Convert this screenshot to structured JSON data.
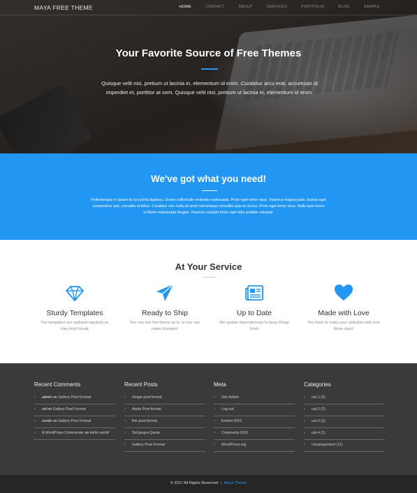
{
  "brand": "MAYA FREE THEME",
  "nav": [
    "HOME",
    "CONTACT",
    "ABOUT",
    "SERVICES",
    "PORTFOLIO",
    "BLOG",
    "SAMPLE"
  ],
  "nav_active": "HOME",
  "hero": {
    "title": "Your Favorite Source of Free Themes",
    "text": "Quisque velit nisi, pretium ut lacinia in, elementum id enim. Curabitur arcu erat, accumsan id imperdiet et, porttitor at sem. Quisque velit nisi, pretium ut lacinia in, elementum id enim."
  },
  "band": {
    "title": "We've got what you need!",
    "text": "Pellentesque in ipsum id orci porta dapibus. Donec sollicitudin molestie malesuada. Proin eget tortor risus. Vivamus magna justo, lacinia eget consectetur sed, convallis at tellus. Curabitur non nulla sit amet nisl tempus convallis quis ac lectus. Proin eget tortor risus. Nulla quis lorem ut libero malesuada feugiat. Vivamus suscipit tortor eget felis porttitor volutpat."
  },
  "services": {
    "title": "At Your Service",
    "items": [
      {
        "icon": "diamond-icon",
        "title": "Sturdy Templates",
        "text": "Our templates are updated regularly so they don't break"
      },
      {
        "icon": "paper-plane-icon",
        "title": "Ready to Ship",
        "text": "You can use this theme as is, or you can make changes!"
      },
      {
        "icon": "newspaper-icon",
        "title": "Up to Date",
        "text": "We update dependencies to keep things fresh"
      },
      {
        "icon": "heart-icon",
        "title": "Made with Love",
        "text": "You have to make your websites with love these days!"
      }
    ],
    "accent": "#2196f3"
  },
  "footer": {
    "recent_comments": {
      "title": "Recent Comments",
      "items": [
        {
          "author": "admin",
          "on": "on",
          "post": "Gallery Post Format"
        },
        {
          "author": "sid",
          "on": "on",
          "post": "Gallery Post Format"
        },
        {
          "author": "sunde",
          "on": "on",
          "post": "Gallery Post Format"
        },
        {
          "author": "A WordPress Commenter",
          "on": "on",
          "post": "Hello world!"
        }
      ]
    },
    "recent_posts": {
      "title": "Recent Posts",
      "items": [
        "Single post format",
        "Aside Post format",
        "link post format",
        "Sid jangra Quote",
        "Gallery Post Format"
      ]
    },
    "meta": {
      "title": "Meta",
      "items": [
        "Site Admin",
        "Log out",
        "Entries RSS",
        "Comments RSS",
        "WordPress.org"
      ]
    },
    "categories": {
      "title": "Categories",
      "items": [
        "cat-1 (2)",
        "cat-2 (2)",
        "cat-3 (2)",
        "cat-4 (1)",
        "Uncategorized (11)"
      ]
    }
  },
  "copyright": {
    "text": "© 2017 All Rights Reserved",
    "separator": "|",
    "link": "Maya Theme"
  },
  "colors": {
    "accent": "#2196f3",
    "footer_bg": "#3a3a3a",
    "bottom_bar_bg": "#262626"
  }
}
